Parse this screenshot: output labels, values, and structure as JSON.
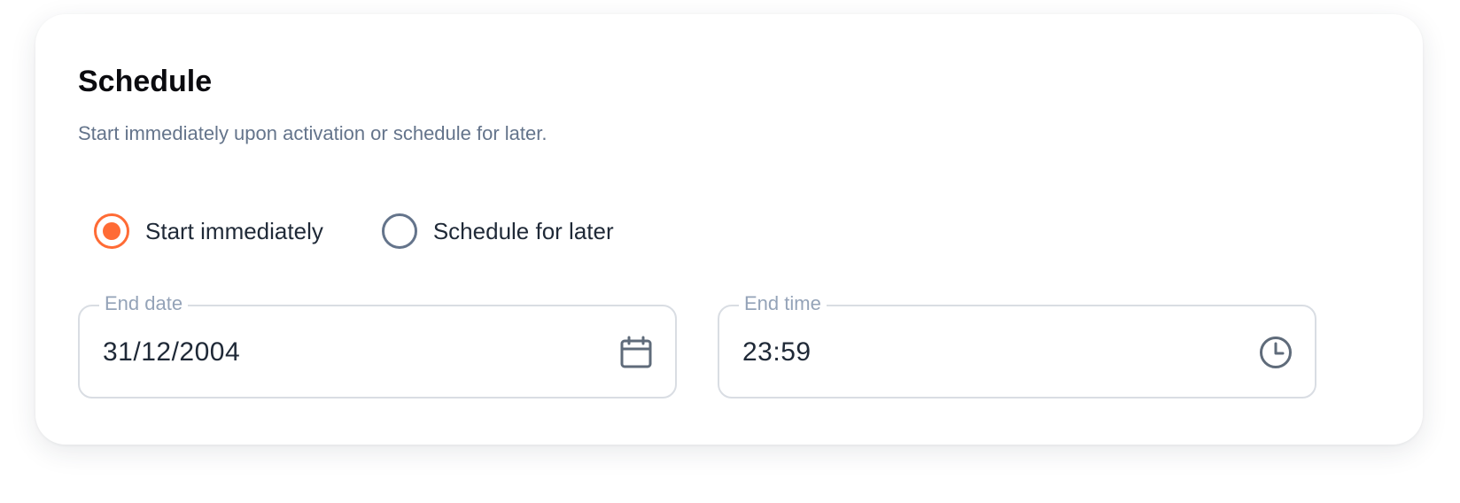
{
  "section": {
    "title": "Schedule",
    "description": "Start immediately upon activation or schedule for later."
  },
  "radio_options": [
    {
      "label": "Start immediately",
      "selected": true
    },
    {
      "label": "Schedule for later",
      "selected": false
    }
  ],
  "fields": {
    "end_date": {
      "label": "End date",
      "value": "31/12/2004",
      "icon": "calendar-icon"
    },
    "end_time": {
      "label": "End time",
      "value": "23:59",
      "icon": "clock-icon"
    }
  },
  "colors": {
    "accent": "#ff6b35",
    "muted_text": "#64748b",
    "label_text": "#94a3b8",
    "border": "#d9dde3"
  }
}
